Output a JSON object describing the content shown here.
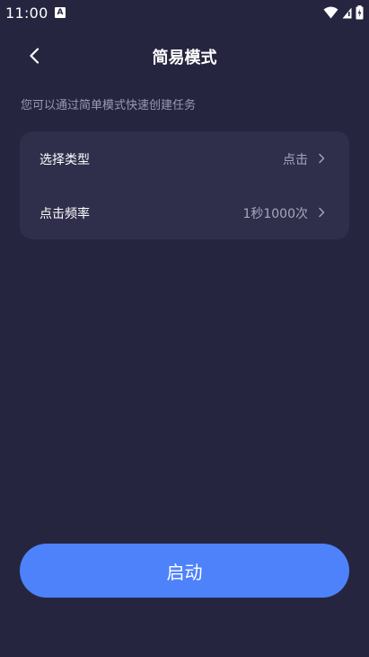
{
  "status_bar": {
    "time": "11:00",
    "app_icon_letter": "A"
  },
  "header": {
    "title": "简易模式"
  },
  "subtitle": "您可以通过简单模式快速创建任务",
  "settings": [
    {
      "label": "选择类型",
      "value": "点击"
    },
    {
      "label": "点击频率",
      "value": "1秒1000次"
    }
  ],
  "start_button": {
    "label": "启动"
  },
  "colors": {
    "background": "#262540",
    "card": "#302f4b",
    "accent": "#4e82fb",
    "secondary_text": "#9a99b2"
  }
}
